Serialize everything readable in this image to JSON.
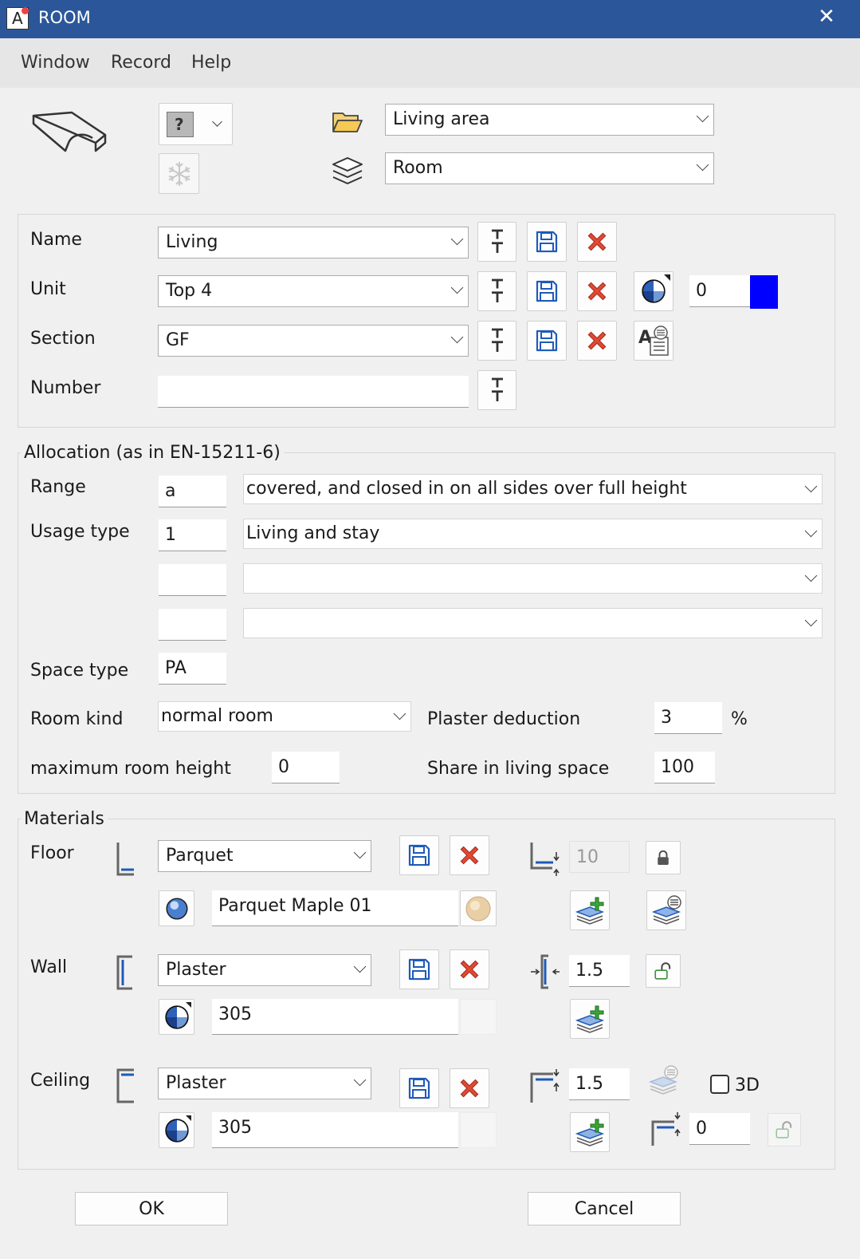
{
  "window": {
    "title": "ROOM",
    "close_glyph": "✕",
    "app_icon_letter": "A"
  },
  "menu": {
    "items": [
      "Window",
      "Record",
      "Help"
    ]
  },
  "header": {
    "folder_value": "Living area",
    "layer_value": "Room",
    "help_glyph": "?"
  },
  "identity": {
    "name_label": "Name",
    "name_value": "Living",
    "unit_label": "Unit",
    "unit_value": "Top 4",
    "unit_color_value": "0",
    "unit_color": "#0000ff",
    "section_label": "Section",
    "section_value": "GF",
    "number_label": "Number",
    "number_value": ""
  },
  "allocation": {
    "legend": "Allocation (as in EN-15211-6)",
    "range_label": "Range",
    "range_code": "a",
    "range_value": "covered, and closed in on all sides over full height",
    "usage_label": "Usage type",
    "usage_code": "1",
    "usage_value": "Living and stay",
    "usage2_code": "",
    "usage2_value": "",
    "usage3_code": "",
    "usage3_value": "",
    "space_type_label": "Space type",
    "space_type_value": "PA",
    "room_kind_label": "Room kind",
    "room_kind_value": "normal room",
    "plaster_deduction_label": "Plaster deduction",
    "plaster_deduction_value": "3",
    "plaster_deduction_unit": "%",
    "max_height_label": "maximum room height",
    "max_height_value": "0",
    "share_label": "Share in living space",
    "share_value": "100"
  },
  "materials": {
    "legend": "Materials",
    "floor": {
      "label": "Floor",
      "material": "Parquet",
      "surface": "Parquet Maple 01",
      "thickness": "10"
    },
    "wall": {
      "label": "Wall",
      "material": "Plaster",
      "surface": "305",
      "thickness": "1.5"
    },
    "ceiling": {
      "label": "Ceiling",
      "material": "Plaster",
      "surface": "305",
      "thickness": "1.5",
      "offset": "0",
      "label_3d": "3D"
    }
  },
  "footer": {
    "ok_label": "OK",
    "cancel_label": "Cancel"
  },
  "colors": {
    "titlebar": "#2b579a",
    "accent_blue": "#1e5bb8",
    "delete_red": "#d9412e"
  }
}
